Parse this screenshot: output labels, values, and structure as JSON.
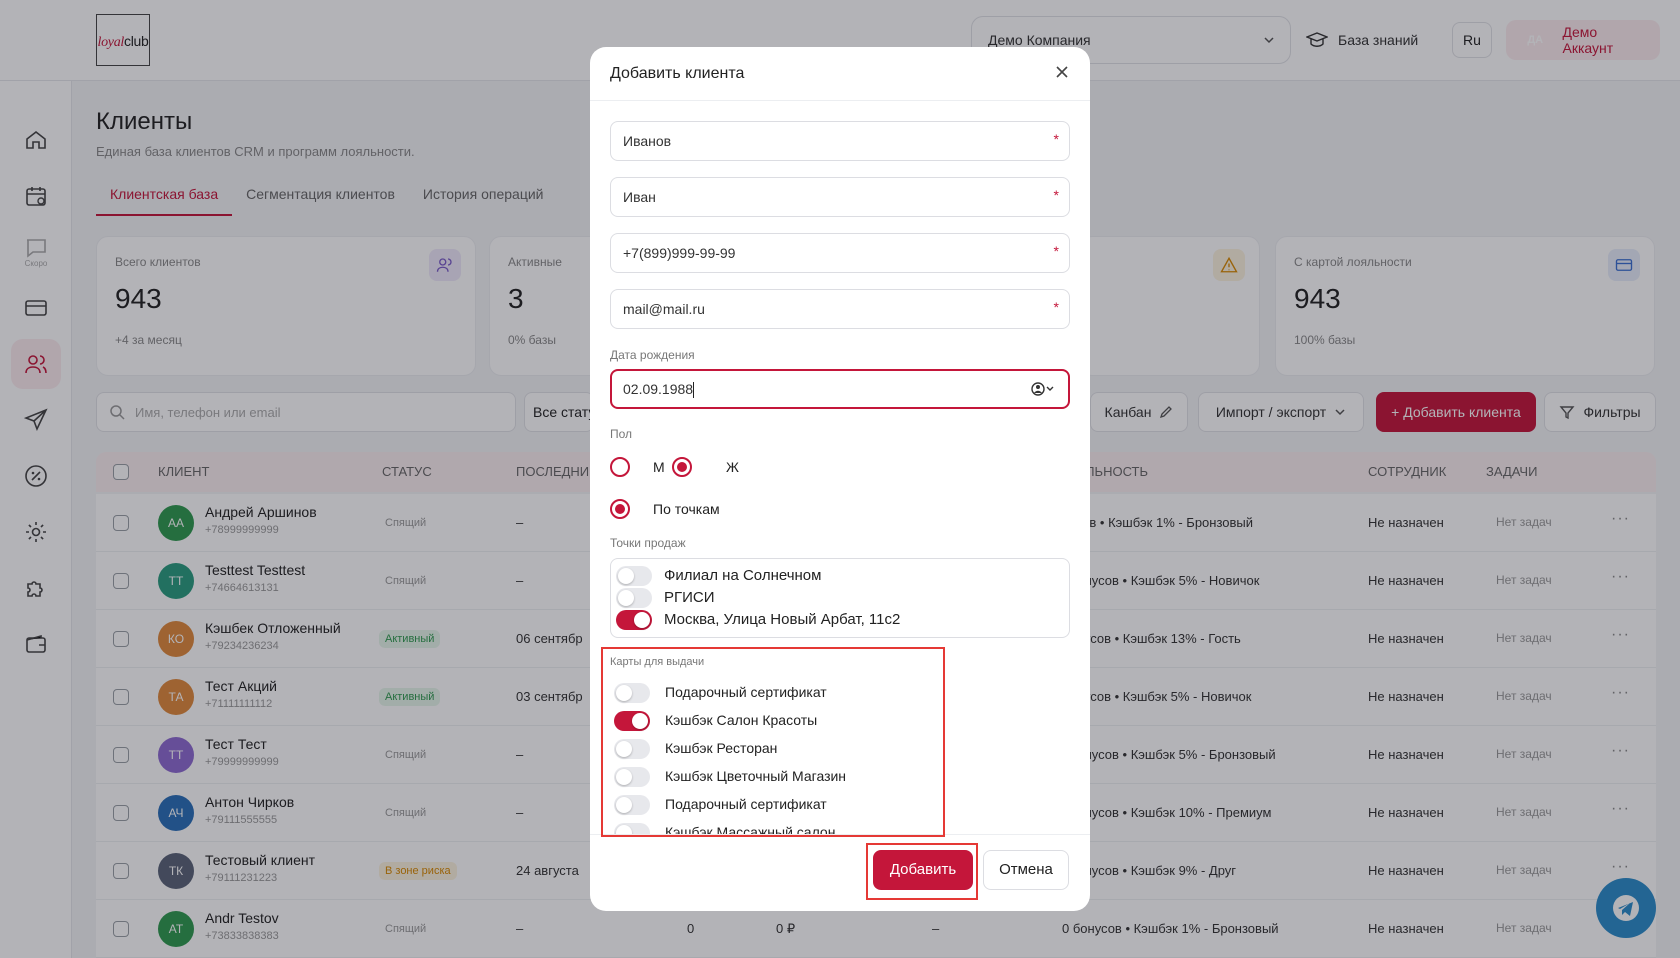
{
  "header": {
    "logo_part1": "loyal",
    "logo_part2": "club",
    "company": "Демо Компания",
    "knowledge_base": "База знаний",
    "language": "Ru",
    "account_initials": "ДА",
    "account_name": "Демо Аккаунт"
  },
  "sidebar": {
    "items": [
      "home-icon",
      "calendar-icon",
      "chat-icon",
      "card-icon",
      "users-icon",
      "send-icon",
      "percent-icon",
      "gear-icon",
      "puzzle-icon",
      "wallet-icon"
    ],
    "chat_label": "Скоро",
    "active": "users-icon"
  },
  "page": {
    "title": "Клиенты",
    "subtitle": "Единая база клиентов CRM и программ лояльности.",
    "tabs": [
      "Клиентская база",
      "Сегментация клиентов",
      "История операций"
    ]
  },
  "stats": [
    {
      "label": "Всего клиентов",
      "value": "943",
      "sub": "+4 за месяц"
    },
    {
      "label": "Активные",
      "value": "3",
      "sub": "0% базы"
    },
    {
      "label": "С картой лояльности",
      "value": "943",
      "sub": "100% базы"
    }
  ],
  "toolbar": {
    "search_placeholder": "Имя, телефон или email",
    "status_filter": "Все стату",
    "kanban": "Канбан",
    "import_export": "Импорт / экспорт",
    "add_client": "+ Добавить клиента",
    "filters": "Фильтры"
  },
  "table": {
    "headers": {
      "client": "КЛИЕНТ",
      "status": "СТАТУС",
      "last": "ПОСЛЕДНИ",
      "loyalty": "ЛЬНОСТЬ",
      "employee": "СОТРУДНИК",
      "tasks": "ЗАДАЧИ"
    },
    "rows": [
      {
        "initials": "АА",
        "color": "#2e9a4e",
        "name": "Андрей Аршинов",
        "phone": "+78999999999",
        "status": "Спящий",
        "status_type": "sleep",
        "last": "–",
        "loyalty": "нусов • Кэшбэк 1% - Бронзовый",
        "employee": "Не назначен",
        "tasks": "Нет задач",
        "dots": "···"
      },
      {
        "initials": "ТТ",
        "color": "#2a9d7f",
        "name": "Testtest Testtest",
        "phone": "+74664613131",
        "status": "Спящий",
        "status_type": "sleep",
        "last": "–",
        "loyalty": ") бонусов • Кэшбэк 5% - Новичок",
        "employee": "Не назначен",
        "tasks": "Нет задач",
        "dots": "···"
      },
      {
        "initials": "КО",
        "color": "#e08a3c",
        "name": "Кэшбек Отложенный",
        "phone": "+79234236234",
        "status": "Активный",
        "status_type": "active",
        "last": "06 сентябр",
        "loyalty": "бонусов • Кэшбэк 13% - Гость",
        "employee": "Не назначен",
        "tasks": "Нет задач",
        "dots": "···"
      },
      {
        "initials": "ТА",
        "color": "#e08a3c",
        "name": "Тест Акций",
        "phone": "+71111111112",
        "status": "Активный",
        "status_type": "active",
        "last": "03 сентябр",
        "loyalty": "бонусов • Кэшбэк 5% - Новичок",
        "employee": "Не назначен",
        "tasks": "Нет задач",
        "dots": "···"
      },
      {
        "initials": "ТТ",
        "color": "#8e6bd1",
        "name": "Тест Тест",
        "phone": "+79999999999",
        "status": "Спящий",
        "status_type": "sleep",
        "last": "–",
        "loyalty": ") бонусов • Кэшбэк 5% - Бронзовый",
        "employee": "Не назначен",
        "tasks": "Нет задач",
        "dots": "···"
      },
      {
        "initials": "АЧ",
        "color": "#2a6fb8",
        "name": "Антон Чирков",
        "phone": "+79111555555",
        "status": "Спящий",
        "status_type": "sleep",
        "last": "–",
        "loyalty": ") бонусов • Кэшбэк 10% - Премиум",
        "employee": "Не назначен",
        "tasks": "Нет задач",
        "dots": "···"
      },
      {
        "initials": "ТК",
        "color": "#5a6478",
        "name": "Тестовый клиент",
        "phone": "+79111231223",
        "status": "В зоне риска",
        "status_type": "risk",
        "last": "24 августа",
        "loyalty": ") бонусов • Кэшбэк 9% - Друг",
        "employee": "Не назначен",
        "tasks": "Нет задач",
        "dots": "···"
      },
      {
        "initials": "АТ",
        "color": "#2e9a4e",
        "name": "Andr Testov",
        "phone": "+73833838383",
        "status": "Спящий",
        "status_type": "sleep",
        "last": "–",
        "extra1": "0",
        "extra2": "0 ₽",
        "extra3": "–",
        "loyalty": "0 бонусов • Кэшбэк 1% - Бронзовый",
        "employee": "Не назначен",
        "tasks": "Нет задач",
        "dots": "···"
      }
    ]
  },
  "modal": {
    "title": "Добавить клиента",
    "last_name": "Иванов",
    "first_name": "Иван",
    "phone": "+7(899)999-99-99",
    "email": "mail@mail.ru",
    "required_mark": "*",
    "birth_label": "Дата рождения",
    "birth_value": "02.09.1988",
    "gender_label": "Пол",
    "gender_m": "М",
    "gender_f": "Ж",
    "gender_selected": "Ж",
    "scope_option": "По точкам",
    "points_label": "Точки продаж",
    "points": [
      {
        "name": "Филиал на Солнечном",
        "on": false
      },
      {
        "name": "РГИСИ",
        "on": false
      },
      {
        "name": "Москва, Улица Новый Арбат, 11с2",
        "on": true
      }
    ],
    "cards_label": "Карты для выдачи",
    "cards": [
      {
        "name": "Подарочный сертификат",
        "on": false
      },
      {
        "name": "Кэшбэк Салон Красоты",
        "on": true
      },
      {
        "name": "Кэшбэк Ресторан",
        "on": false
      },
      {
        "name": "Кэшбэк Цветочный Магазин",
        "on": false
      },
      {
        "name": "Подарочный сертификат",
        "on": false
      },
      {
        "name": "Кэшбэк Массажный салон",
        "on": false
      }
    ],
    "add_button": "Добавить",
    "cancel_button": "Отмена"
  },
  "colors": {
    "accent": "#c4163a",
    "highlight": "#e53935",
    "telegram": "#2c8ccb"
  }
}
